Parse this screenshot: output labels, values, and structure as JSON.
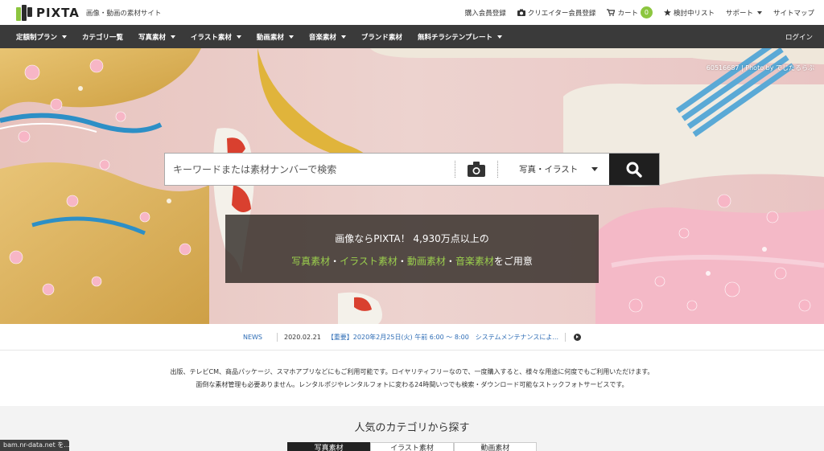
{
  "header": {
    "logo_text": "PIXTA",
    "tagline": "画像・動画の素材サイト",
    "links": {
      "register": "購入会員登録",
      "creator": "クリエイター会員登録",
      "cart": "カート",
      "cart_count": "0",
      "wishlist": "検討中リスト",
      "support": "サポート",
      "sitemap": "サイトマップ"
    }
  },
  "nav": {
    "items": [
      "定額制プラン",
      "カテゴリ一覧",
      "写真素材",
      "イラスト素材",
      "動画素材",
      "音楽素材",
      "ブランド素材",
      "無料チラシテンプレート"
    ],
    "login": "ログイン"
  },
  "hero": {
    "photo_credit": "60516687 | Photo by でじたるらぶ",
    "search": {
      "placeholder": "キーワードまたは素材ナンバーで検索",
      "type_selected": "写真・イラスト"
    },
    "promo": {
      "line1": "画像ならPIXTA！ 4,930万点以上の",
      "photo": "写真素材",
      "illust": "イラスト素材",
      "video": "動画素材",
      "music": "音楽素材",
      "dot": "・",
      "suffix": "をご用意"
    }
  },
  "news": {
    "label": "NEWS",
    "date": "2020.02.21",
    "text": "【重要】2020年2月25日(火) 午前 6:00 〜 8:00　システムメンテナンスによ..."
  },
  "description": {
    "line1": "出版、テレビCM、商品パッケージ、スマホアプリなどにもご利用可能です。ロイヤリティフリーなので、一度購入すると、様々な用途に何度でもご利用いただけます。",
    "line2": "面倒な素材管理も必要ありません。レンタルポジやレンタルフォトに変わる24時間いつでも検索・ダウンロード可能なストックフォトサービスです。"
  },
  "categories": {
    "title": "人気のカテゴリから探す",
    "tabs": [
      "写真素材",
      "イラスト素材",
      "動画素材"
    ]
  },
  "status_bar": "bam.nr-data.net を..."
}
